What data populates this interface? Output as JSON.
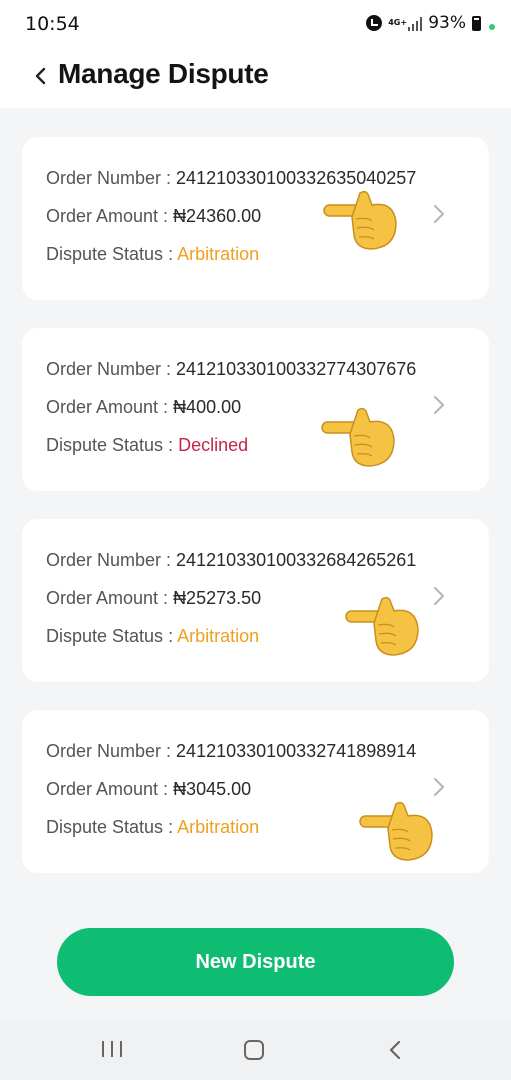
{
  "status_bar": {
    "time": "10:54",
    "network": "4G+",
    "battery": "93%"
  },
  "header": {
    "title": "Manage Dispute"
  },
  "labels": {
    "order_number": "Order Number : ",
    "order_amount": "Order Amount : ",
    "dispute_status": "Dispute Status : "
  },
  "disputes": [
    {
      "order_number": "241210330100332635040257",
      "order_amount": "₦24360.00",
      "status": "Arbitration"
    },
    {
      "order_number": "241210330100332774307676",
      "order_amount": "₦400.00",
      "status": "Declined"
    },
    {
      "order_number": "241210330100332684265261",
      "order_amount": "₦25273.50",
      "status": "Arbitration"
    },
    {
      "order_number": "241210330100332741898914",
      "order_amount": "₦3045.00",
      "status": "Arbitration"
    }
  ],
  "colors": {
    "primary": "#0fbd72",
    "status_arbitration": "#f0a020",
    "status_declined": "#c2264a"
  },
  "icons": {
    "pointer": "backhand-index-pointing-left-icon",
    "chevron": "chevron-right-icon"
  },
  "footer": {
    "new_dispute_label": "New Dispute"
  }
}
